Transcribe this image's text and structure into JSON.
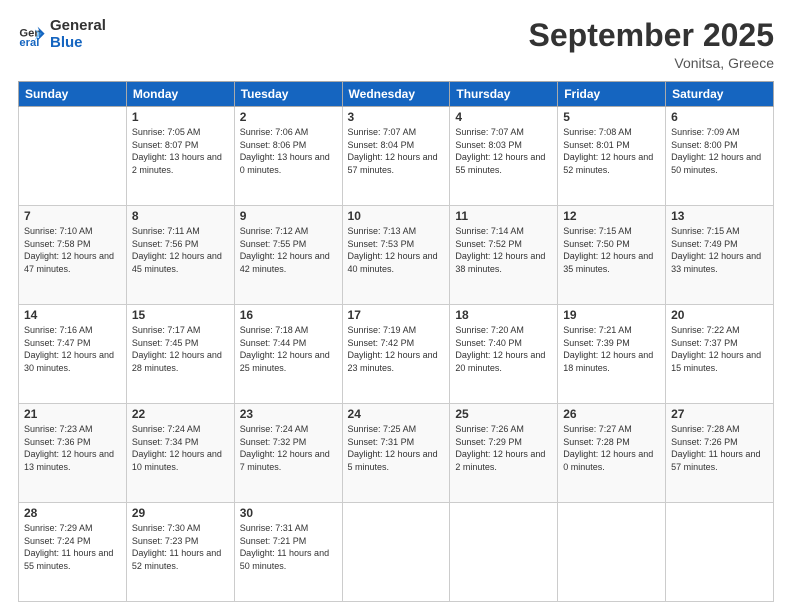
{
  "logo": {
    "line1": "General",
    "line2": "Blue"
  },
  "title": "September 2025",
  "subtitle": "Vonitsa, Greece",
  "days_of_week": [
    "Sunday",
    "Monday",
    "Tuesday",
    "Wednesday",
    "Thursday",
    "Friday",
    "Saturday"
  ],
  "weeks": [
    [
      {
        "day": "",
        "sunrise": "",
        "sunset": "",
        "daylight": ""
      },
      {
        "day": "1",
        "sunrise": "7:05 AM",
        "sunset": "8:07 PM",
        "daylight": "13 hours and 2 minutes."
      },
      {
        "day": "2",
        "sunrise": "7:06 AM",
        "sunset": "8:06 PM",
        "daylight": "13 hours and 0 minutes."
      },
      {
        "day": "3",
        "sunrise": "7:07 AM",
        "sunset": "8:04 PM",
        "daylight": "12 hours and 57 minutes."
      },
      {
        "day": "4",
        "sunrise": "7:07 AM",
        "sunset": "8:03 PM",
        "daylight": "12 hours and 55 minutes."
      },
      {
        "day": "5",
        "sunrise": "7:08 AM",
        "sunset": "8:01 PM",
        "daylight": "12 hours and 52 minutes."
      },
      {
        "day": "6",
        "sunrise": "7:09 AM",
        "sunset": "8:00 PM",
        "daylight": "12 hours and 50 minutes."
      }
    ],
    [
      {
        "day": "7",
        "sunrise": "7:10 AM",
        "sunset": "7:58 PM",
        "daylight": "12 hours and 47 minutes."
      },
      {
        "day": "8",
        "sunrise": "7:11 AM",
        "sunset": "7:56 PM",
        "daylight": "12 hours and 45 minutes."
      },
      {
        "day": "9",
        "sunrise": "7:12 AM",
        "sunset": "7:55 PM",
        "daylight": "12 hours and 42 minutes."
      },
      {
        "day": "10",
        "sunrise": "7:13 AM",
        "sunset": "7:53 PM",
        "daylight": "12 hours and 40 minutes."
      },
      {
        "day": "11",
        "sunrise": "7:14 AM",
        "sunset": "7:52 PM",
        "daylight": "12 hours and 38 minutes."
      },
      {
        "day": "12",
        "sunrise": "7:15 AM",
        "sunset": "7:50 PM",
        "daylight": "12 hours and 35 minutes."
      },
      {
        "day": "13",
        "sunrise": "7:15 AM",
        "sunset": "7:49 PM",
        "daylight": "12 hours and 33 minutes."
      }
    ],
    [
      {
        "day": "14",
        "sunrise": "7:16 AM",
        "sunset": "7:47 PM",
        "daylight": "12 hours and 30 minutes."
      },
      {
        "day": "15",
        "sunrise": "7:17 AM",
        "sunset": "7:45 PM",
        "daylight": "12 hours and 28 minutes."
      },
      {
        "day": "16",
        "sunrise": "7:18 AM",
        "sunset": "7:44 PM",
        "daylight": "12 hours and 25 minutes."
      },
      {
        "day": "17",
        "sunrise": "7:19 AM",
        "sunset": "7:42 PM",
        "daylight": "12 hours and 23 minutes."
      },
      {
        "day": "18",
        "sunrise": "7:20 AM",
        "sunset": "7:40 PM",
        "daylight": "12 hours and 20 minutes."
      },
      {
        "day": "19",
        "sunrise": "7:21 AM",
        "sunset": "7:39 PM",
        "daylight": "12 hours and 18 minutes."
      },
      {
        "day": "20",
        "sunrise": "7:22 AM",
        "sunset": "7:37 PM",
        "daylight": "12 hours and 15 minutes."
      }
    ],
    [
      {
        "day": "21",
        "sunrise": "7:23 AM",
        "sunset": "7:36 PM",
        "daylight": "12 hours and 13 minutes."
      },
      {
        "day": "22",
        "sunrise": "7:24 AM",
        "sunset": "7:34 PM",
        "daylight": "12 hours and 10 minutes."
      },
      {
        "day": "23",
        "sunrise": "7:24 AM",
        "sunset": "7:32 PM",
        "daylight": "12 hours and 7 minutes."
      },
      {
        "day": "24",
        "sunrise": "7:25 AM",
        "sunset": "7:31 PM",
        "daylight": "12 hours and 5 minutes."
      },
      {
        "day": "25",
        "sunrise": "7:26 AM",
        "sunset": "7:29 PM",
        "daylight": "12 hours and 2 minutes."
      },
      {
        "day": "26",
        "sunrise": "7:27 AM",
        "sunset": "7:28 PM",
        "daylight": "12 hours and 0 minutes."
      },
      {
        "day": "27",
        "sunrise": "7:28 AM",
        "sunset": "7:26 PM",
        "daylight": "11 hours and 57 minutes."
      }
    ],
    [
      {
        "day": "28",
        "sunrise": "7:29 AM",
        "sunset": "7:24 PM",
        "daylight": "11 hours and 55 minutes."
      },
      {
        "day": "29",
        "sunrise": "7:30 AM",
        "sunset": "7:23 PM",
        "daylight": "11 hours and 52 minutes."
      },
      {
        "day": "30",
        "sunrise": "7:31 AM",
        "sunset": "7:21 PM",
        "daylight": "11 hours and 50 minutes."
      },
      {
        "day": "",
        "sunrise": "",
        "sunset": "",
        "daylight": ""
      },
      {
        "day": "",
        "sunrise": "",
        "sunset": "",
        "daylight": ""
      },
      {
        "day": "",
        "sunrise": "",
        "sunset": "",
        "daylight": ""
      },
      {
        "day": "",
        "sunrise": "",
        "sunset": "",
        "daylight": ""
      }
    ]
  ]
}
